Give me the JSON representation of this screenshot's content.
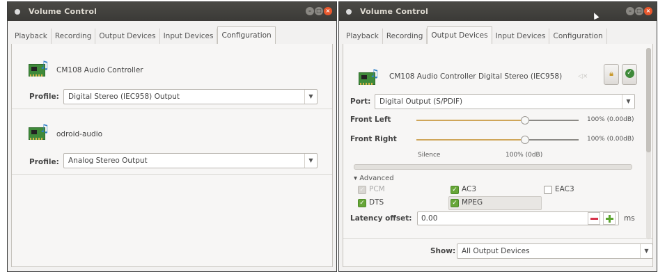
{
  "win1": {
    "title": "Volume Control",
    "tabs": [
      "Playback",
      "Recording",
      "Output Devices",
      "Input Devices",
      "Configuration"
    ],
    "active_tab": "Configuration",
    "devices": [
      {
        "name": "CM108 Audio Controller",
        "profile_label": "Profile:",
        "profile_value": "Digital Stereo (IEC958) Output"
      },
      {
        "name": "odroid-audio",
        "profile_label": "Profile:",
        "profile_value": "Analog Stereo Output"
      }
    ]
  },
  "win2": {
    "title": "Volume Control",
    "tabs": [
      "Playback",
      "Recording",
      "Output Devices",
      "Input Devices",
      "Configuration"
    ],
    "active_tab": "Output Devices",
    "device_name": "CM108 Audio Controller Digital Stereo (IEC958)",
    "port_label": "Port:",
    "port_value": "Digital Output (S/PDIF)",
    "channels": [
      {
        "name": "Front Left",
        "value_text": "100% (0.00dB)",
        "level": 1.0
      },
      {
        "name": "Front Right",
        "value_text": "100% (0.00dB)",
        "level": 1.0
      }
    ],
    "scale_silence": "Silence",
    "scale_100": "100% (0dB)",
    "advanced_label": "Advanced",
    "advanced_toggle": "▾",
    "formats": [
      {
        "label": "PCM",
        "checked": true,
        "disabled": true
      },
      {
        "label": "AC3",
        "checked": true,
        "disabled": false
      },
      {
        "label": "EAC3",
        "checked": false,
        "disabled": false
      },
      {
        "label": "DTS",
        "checked": true,
        "disabled": false
      },
      {
        "label": "MPEG",
        "checked": true,
        "disabled": false
      }
    ],
    "latency_label": "Latency offset:",
    "latency_value": "0.00",
    "latency_unit": "ms",
    "show_label": "Show:",
    "show_value": "All Output Devices"
  },
  "colors": {
    "accent_green": "#67a638",
    "close_orange": "#e9582d",
    "titlebar": "#3b3a37"
  },
  "icons": {
    "card": "sound-card-icon",
    "lock": "lock-icon",
    "default": "checkmark-icon"
  }
}
